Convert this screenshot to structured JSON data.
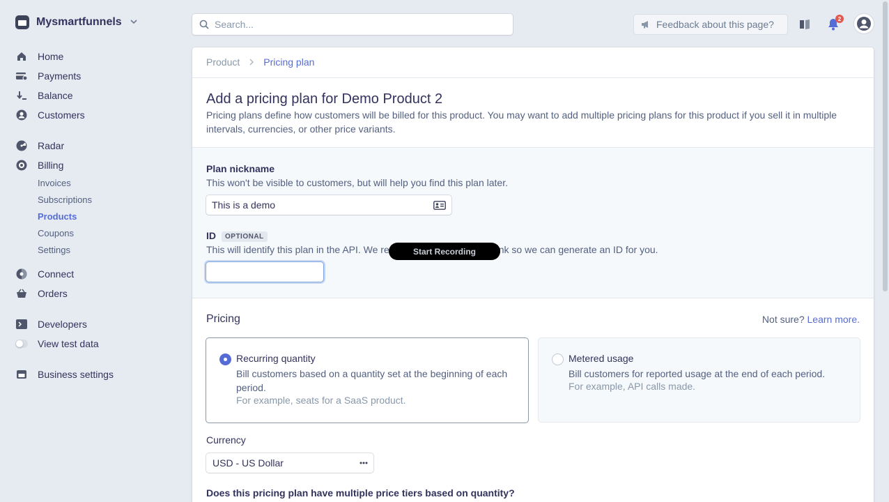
{
  "account": {
    "name": "Mysmartfunnels"
  },
  "nav": {
    "home": "Home",
    "payments": "Payments",
    "balance": "Balance",
    "customers": "Customers",
    "radar": "Radar",
    "billing": "Billing",
    "billing_sub": [
      "Invoices",
      "Subscriptions",
      "Products",
      "Coupons",
      "Settings"
    ],
    "connect": "Connect",
    "orders": "Orders",
    "developers": "Developers",
    "test_data": "View test data",
    "business_settings": "Business settings"
  },
  "topbar": {
    "search_placeholder": "Search...",
    "feedback": "Feedback about this page?",
    "notification_count": "2"
  },
  "breadcrumb": [
    "Product",
    "Pricing plan"
  ],
  "page": {
    "title": "Add a pricing plan for Demo Product 2",
    "description": "Pricing plans define how customers will be billed for this product. You may want to add multiple pricing plans for this product if you sell it in multiple intervals, currencies, or other price variants."
  },
  "form": {
    "nickname_label": "Plan nickname",
    "nickname_help": "This won't be visible to customers, but will help you find this plan later.",
    "nickname_value": "This is a demo",
    "id_label": "ID",
    "id_optional": "OPTIONAL",
    "id_help_start": "This will identify this plan in the API. We re",
    "id_help_end": "nk so we can generate an ID for you.",
    "id_value": ""
  },
  "recording": {
    "label": "Start Recording"
  },
  "pricing": {
    "title": "Pricing",
    "not_sure": "Not sure?",
    "learn_more": "Learn more.",
    "options": [
      {
        "title": "Recurring quantity",
        "description": "Bill customers based on a quantity set at the beginning of each period.",
        "example": "For example, seats for a SaaS product.",
        "selected": true
      },
      {
        "title": "Metered usage",
        "description": "Bill customers for reported usage at the end of each period.",
        "example": "For example, API calls made.",
        "selected": false
      }
    ],
    "currency_label": "Currency",
    "currency_value": "USD - US Dollar",
    "tiers_question": "Does this pricing plan have multiple price tiers based on quantity?"
  },
  "colors": {
    "accent": "#556cd6",
    "background": "#e6ebf1",
    "text": "#32325d",
    "badge": "#e25950"
  }
}
